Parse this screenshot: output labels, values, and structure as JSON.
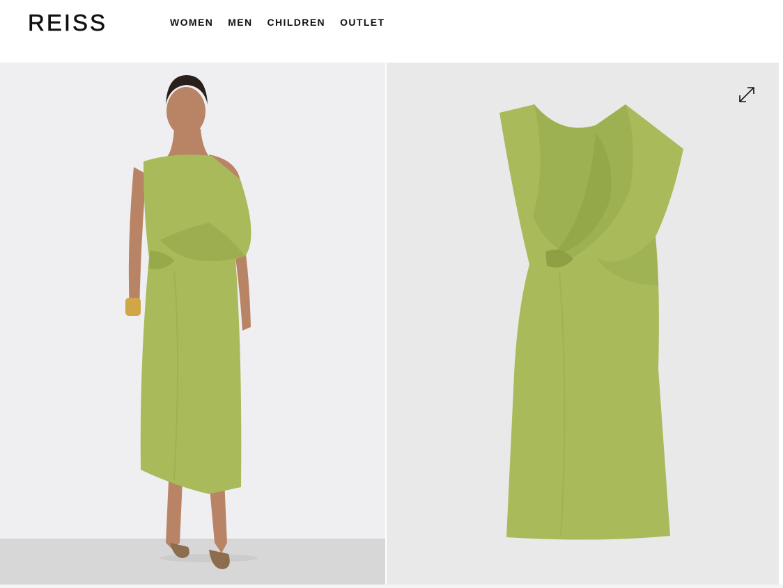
{
  "brand": {
    "logo_text": "REISS"
  },
  "nav": {
    "items": [
      "WOMEN",
      "MEN",
      "CHILDREN",
      "OUTLET"
    ]
  },
  "gallery": {
    "images": [
      {
        "alt": "Model wearing green draped one-shoulder midi dress"
      },
      {
        "alt": "Green draped midi dress flat lay"
      }
    ],
    "expand_icon": "expand-icon"
  },
  "colors": {
    "dress": "#a9ba5a",
    "dress_shadow": "#8fa244",
    "background_left": "#efeff0",
    "background_right": "#e9e9ea",
    "text": "#111111"
  }
}
